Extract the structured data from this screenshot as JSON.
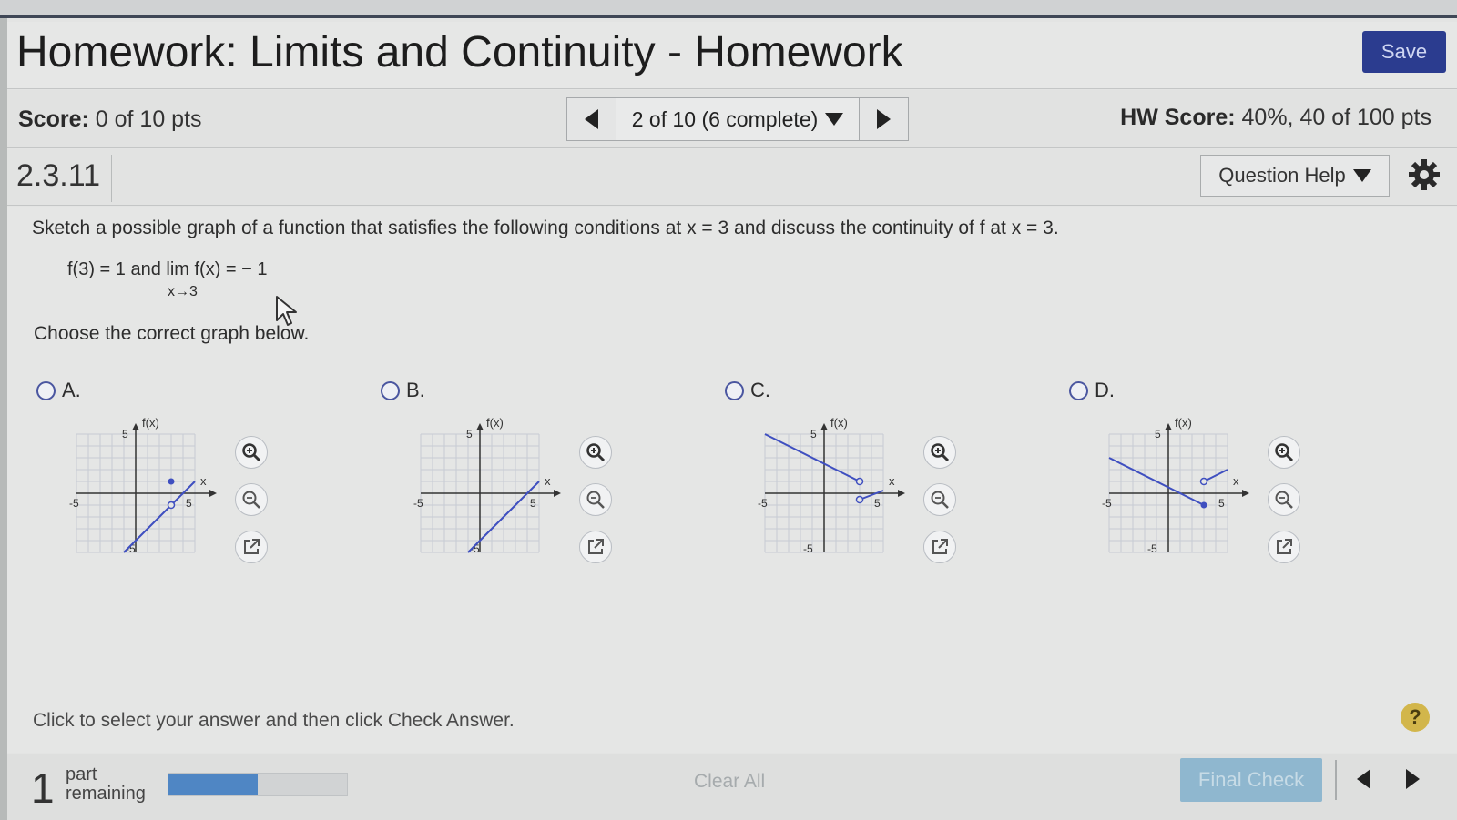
{
  "window": {
    "title": "Homework: Limits and Continuity - Homework",
    "save_label": "Save"
  },
  "scorebar": {
    "score_label": "Score:",
    "score_value": "0 of 10 pts",
    "progress_text": "2 of 10 (6 complete)",
    "hw_score_label": "HW Score:",
    "hw_score_value": "40%, 40 of 100 pts"
  },
  "question": {
    "number": "2.3.11",
    "help_label": "Question Help",
    "prompt": "Sketch a possible graph of a function that satisfies the following conditions at x = 3 and discuss the continuity of f at x = 3.",
    "condition": "f(3) = 1 and lim f(x) = − 1",
    "limit_subscript": "x→3",
    "instruction": "Choose the correct graph below.",
    "options": [
      {
        "letter": "A.",
        "selected": false
      },
      {
        "letter": "B.",
        "selected": false
      },
      {
        "letter": "C.",
        "selected": false
      },
      {
        "letter": "D.",
        "selected": false
      }
    ],
    "graph_labels": {
      "fx": "f(x)",
      "x": "x",
      "five": "5",
      "neg_five": "-5"
    },
    "hint": "Click to select your answer and then click Check Answer."
  },
  "footer": {
    "part_count": "1",
    "part_label_1": "part",
    "part_label_2": "remaining",
    "progress_fraction": 0.5,
    "clear_all_label": "Clear All",
    "final_check_label": "Final Check"
  },
  "colors": {
    "save_button": "#2b3c8f",
    "graph_line": "#3f4fc0",
    "final_check": "#8fb7cf",
    "progress_fill": "#4f86c4",
    "help_circle": "#d2b64b"
  },
  "icons": [
    "zoom-in-icon",
    "zoom-out-icon",
    "pop-out-icon",
    "gear-icon",
    "help-icon",
    "prev-arrow-icon",
    "next-arrow-icon",
    "dropdown-arrow-icon",
    "mouse-cursor-icon"
  ]
}
